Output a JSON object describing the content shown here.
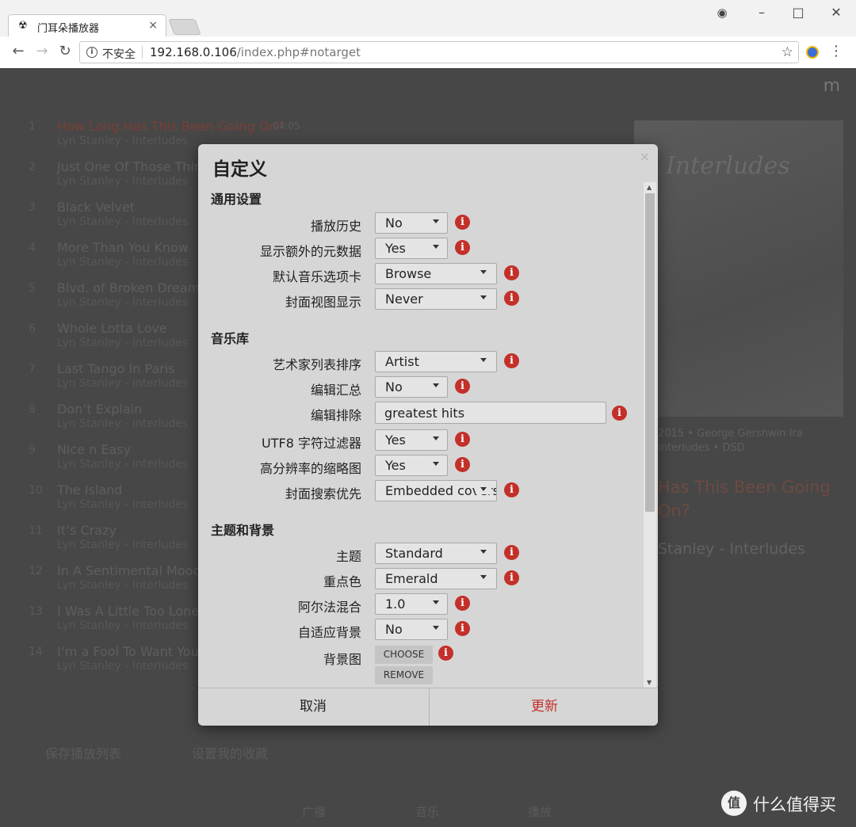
{
  "browser": {
    "tab_title": "门耳朵播放器",
    "tab_icon": "☢",
    "tab_close": "×",
    "security_label": "不安全",
    "url_host": "192.168.0.106",
    "url_path": "/index.php#notarget",
    "win_minimize": "–",
    "win_maximize": "□",
    "win_close": "✕",
    "profile_icon": "◉"
  },
  "background_page": {
    "logo": "m",
    "playlist": [
      {
        "num": "1",
        "title": "How Long Has This Been Going On?",
        "sub": "Lyn Stanley - Interludes",
        "time": "04:05"
      },
      {
        "num": "2",
        "title": "Just One Of Those Things",
        "sub": "Lyn Stanley - Interludes",
        "time": ""
      },
      {
        "num": "3",
        "title": "Black Velvet",
        "sub": "Lyn Stanley - Interludes",
        "time": ""
      },
      {
        "num": "4",
        "title": "More Than You Know",
        "sub": "Lyn Stanley - Interludes",
        "time": ""
      },
      {
        "num": "5",
        "title": "Blvd. of Broken Dreams",
        "sub": "Lyn Stanley - Interludes",
        "time": ""
      },
      {
        "num": "6",
        "title": "Whole Lotta Love",
        "sub": "Lyn Stanley - Interludes",
        "time": ""
      },
      {
        "num": "7",
        "title": "Last Tango In Paris",
        "sub": "Lyn Stanley - Interludes",
        "time": ""
      },
      {
        "num": "8",
        "title": "Don’t Explain",
        "sub": "Lyn Stanley - Interludes",
        "time": ""
      },
      {
        "num": "9",
        "title": "Nice n Easy",
        "sub": "Lyn Stanley - Interludes",
        "time": ""
      },
      {
        "num": "10",
        "title": "The Island",
        "sub": "Lyn Stanley - Interludes",
        "time": ""
      },
      {
        "num": "11",
        "title": "It’s Crazy",
        "sub": "Lyn Stanley - Interludes",
        "time": ""
      },
      {
        "num": "12",
        "title": "In A Sentimental Mood",
        "sub": "Lyn Stanley - Interludes",
        "time": ""
      },
      {
        "num": "13",
        "title": "I Was A Little Too Lonely",
        "sub": "Lyn Stanley - Interludes",
        "time": ""
      },
      {
        "num": "14",
        "title": "I’m a Fool To Want You",
        "sub": "Lyn Stanley - Interludes",
        "time": ""
      }
    ],
    "save_playlist": "保存播放列表",
    "set_favorites": "设置我的收藏",
    "cover_script": "Interludes",
    "np_line1": "2015 • George Gershwin Ira",
    "np_line2": "Interludes • DSD",
    "np_title": "Has This Been Going On?",
    "np_artist": "Stanley - Interludes",
    "nav": [
      "广播",
      "音乐",
      "播放"
    ],
    "watermark": "什么值得买"
  },
  "modal": {
    "title": "自定义",
    "close": "×",
    "sections": {
      "general": "通用设置",
      "library": "音乐库",
      "theme": "主题和背景"
    },
    "general": {
      "play_history": {
        "label": "播放历史",
        "value": "No"
      },
      "extra_metadata": {
        "label": "显示额外的元数据",
        "value": "Yes"
      },
      "default_tab": {
        "label": "默认音乐选项卡",
        "value": "Browse"
      },
      "coverview": {
        "label": "封面视图显示",
        "value": "Never"
      }
    },
    "library": {
      "artist_sort": {
        "label": "艺术家列表排序",
        "value": "Artist"
      },
      "compilations": {
        "label": "编辑汇总",
        "value": "No"
      },
      "compilation_exclude": {
        "label": "编辑排除",
        "value": "greatest hits"
      },
      "utf8_filter": {
        "label": "UTF8 字符过滤器",
        "value": "Yes"
      },
      "hires_thumbs": {
        "label": "高分辨率的缩略图",
        "value": "Yes"
      },
      "cover_search": {
        "label": "封面搜索优先",
        "value": "Embedded covers"
      }
    },
    "theme": {
      "theme": {
        "label": "主题",
        "value": "Standard"
      },
      "accent": {
        "label": "重点色",
        "value": "Emerald"
      },
      "alpha": {
        "label": "阿尔法混合",
        "value": "1.0"
      },
      "adaptive_bg": {
        "label": "自适应背景",
        "value": "No"
      },
      "bg_image": {
        "label": "背景图",
        "choose": "CHOOSE",
        "remove": "REMOVE"
      }
    },
    "info_glyph": "i",
    "cancel": "取消",
    "update": "更新"
  },
  "colors": {
    "accent_red": "#c3302a",
    "modal_bg": "#d6d6d6",
    "overlay_bg": "#474747"
  }
}
